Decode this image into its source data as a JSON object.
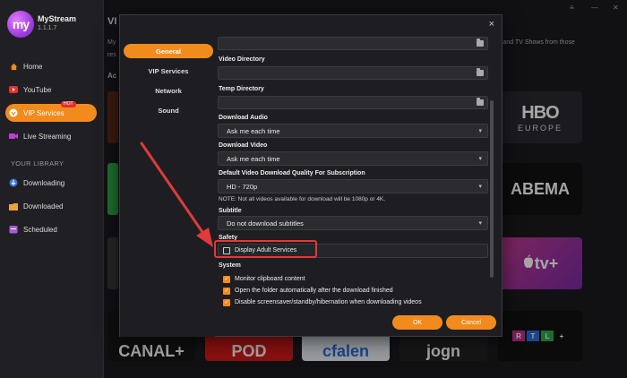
{
  "app": {
    "name": "MyStream",
    "version": "1.1.1.7",
    "logo_text": "my"
  },
  "sidebar": {
    "items": [
      {
        "label": "Home"
      },
      {
        "label": "YouTube"
      },
      {
        "label": "VIP Services",
        "badge": "HOT"
      },
      {
        "label": "Live Streaming"
      }
    ],
    "library_heading": "YOUR LIBRARY",
    "library_items": [
      {
        "label": "Downloading"
      },
      {
        "label": "Downloaded"
      },
      {
        "label": "Scheduled"
      }
    ]
  },
  "background": {
    "title": "VI",
    "desc_left": "My",
    "desc_right": "s and TV Shows from those",
    "desc_res": "res",
    "section": "Ac",
    "tiles": {
      "hbo_big": "HBO",
      "hbo_small": "EUROPE",
      "abema": "ABEMA",
      "appletv": "tv+",
      "rtl": [
        "R",
        "T",
        "L",
        "+"
      ],
      "bottom": [
        "CANAL+",
        "POD",
        "cfalen",
        "jogn"
      ]
    }
  },
  "dialog": {
    "close": "×",
    "tabs": [
      {
        "label": "General"
      },
      {
        "label": "VIP Services"
      },
      {
        "label": "Network"
      },
      {
        "label": "Sound"
      }
    ],
    "labels": {
      "video_directory": "Video Directory",
      "temp_directory": "Temp Directory",
      "download_audio": "Download Audio",
      "download_video": "Download Video",
      "quality": "Default Video Download Quality For Subscription",
      "subtitle": "Subtitle",
      "safety": "Safety",
      "system": "System"
    },
    "values": {
      "download_audio": "Ask me each time",
      "download_video": "Ask me each time",
      "quality": "HD - 720p",
      "subtitle": "Do not download subtitles"
    },
    "note": "NOTE: Not all videos available for download will be 1080p or 4K.",
    "adult": {
      "label": "Display Adult Services",
      "checked": false
    },
    "system_options": [
      {
        "label": "Monitor clipboard content",
        "checked": true
      },
      {
        "label": "Open the folder automatically after the download finished",
        "checked": true
      },
      {
        "label": "Disable screensaver/standby/hibernation when downloading videos",
        "checked": true
      }
    ],
    "ok": "OK",
    "cancel": "Cancel"
  },
  "colors": {
    "accent": "#f28b1e",
    "highlight": "#e03a3a"
  }
}
